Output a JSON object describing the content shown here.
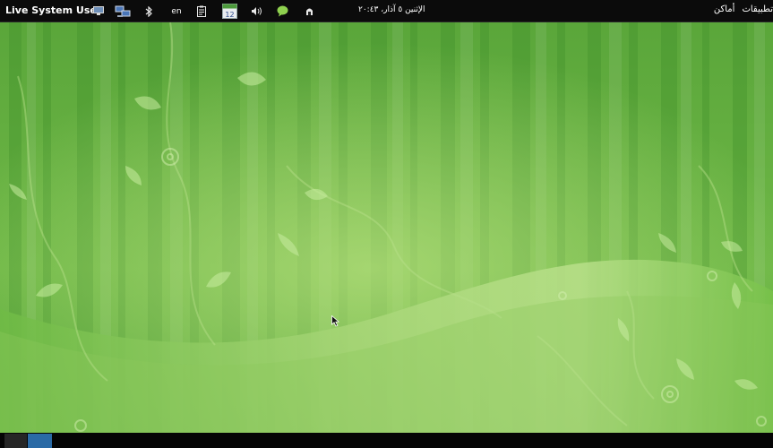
{
  "top_panel": {
    "user_menu_label": "Live System User",
    "indicators": {
      "keyboard_layout": "en",
      "calendar_day": "12"
    },
    "clock": "الإثنين ٥ آذار، ٢٠:٤٣",
    "menu": {
      "applications": "تطبيقات",
      "places": "أماكن"
    },
    "colors": {
      "panel_bg": "#0b0b0b",
      "text": "#ffffff"
    }
  },
  "desktop": {
    "wallpaper": "green-vines-stripes",
    "colors": {
      "dark_green": "#3f8f2a",
      "mid_green": "#6db543",
      "light_green": "#b9e08a"
    }
  },
  "bottom_panel": {
    "workspaces": [
      "workspace-1",
      "workspace-2"
    ],
    "colors": {
      "active_workspace": "#2a6aa5",
      "inactive_workspace": "#262626"
    }
  }
}
